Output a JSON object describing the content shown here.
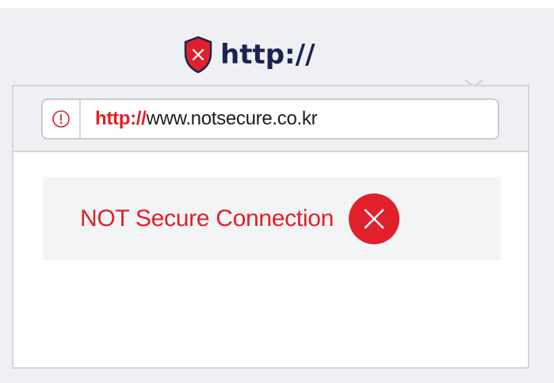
{
  "heading": {
    "protocol_text": "http://",
    "icon": "shield-x-icon"
  },
  "address_bar": {
    "icon": "alert-circle-icon",
    "scheme": "http://",
    "host": "www.notsecure.co.kr"
  },
  "warning": {
    "message": "NOT Secure Connection",
    "icon": "close-circle-icon"
  },
  "colors": {
    "danger": "#e0202a",
    "navy": "#1a2451",
    "panel": "#eef0f3",
    "border": "#d4d7db"
  }
}
